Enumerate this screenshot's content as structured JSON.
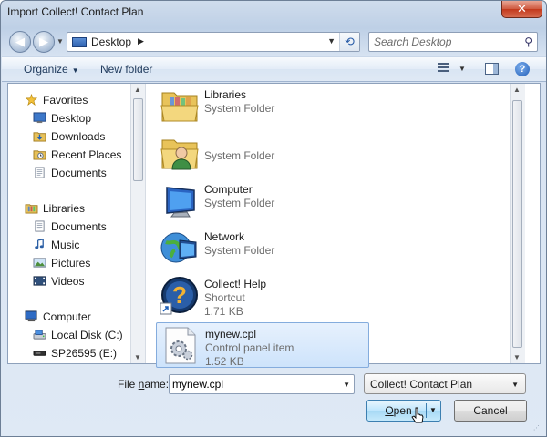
{
  "window": {
    "title": "Import Collect! Contact Plan",
    "close_label": "✕"
  },
  "address_bar": {
    "location": "Desktop",
    "search_placeholder": "Search Desktop"
  },
  "toolbar": {
    "organize_label": "Organize",
    "new_folder_label": "New folder"
  },
  "nav_pane": {
    "groups": [
      {
        "label": "Favorites",
        "icon": "star-icon",
        "children": [
          {
            "label": "Desktop",
            "icon": "desktop-icon"
          },
          {
            "label": "Downloads",
            "icon": "downloads-icon"
          },
          {
            "label": "Recent Places",
            "icon": "recent-places-icon"
          },
          {
            "label": "Documents",
            "icon": "documents-icon"
          }
        ]
      },
      {
        "label": "Libraries",
        "icon": "libraries-icon",
        "children": [
          {
            "label": "Documents",
            "icon": "documents-icon"
          },
          {
            "label": "Music",
            "icon": "music-icon"
          },
          {
            "label": "Pictures",
            "icon": "pictures-icon"
          },
          {
            "label": "Videos",
            "icon": "videos-icon"
          }
        ]
      },
      {
        "label": "Computer",
        "icon": "computer-icon",
        "children": [
          {
            "label": "Local Disk (C:)",
            "icon": "local-disk-icon"
          },
          {
            "label": "SP26595 (E:)",
            "icon": "drive-icon"
          }
        ]
      }
    ]
  },
  "files": [
    {
      "name": "Libraries",
      "type": "System Folder",
      "size": "",
      "icon": "libraries-folder-icon",
      "selected": false
    },
    {
      "name": "",
      "type": "System Folder",
      "size": "",
      "icon": "user-folder-icon",
      "selected": false
    },
    {
      "name": "Computer",
      "type": "System Folder",
      "size": "",
      "icon": "computer-icon",
      "selected": false
    },
    {
      "name": "Network",
      "type": "System Folder",
      "size": "",
      "icon": "network-icon",
      "selected": false
    },
    {
      "name": "Collect! Help",
      "type": "Shortcut",
      "size": "1.71 KB",
      "icon": "help-shortcut-icon",
      "selected": false
    },
    {
      "name": "mynew.cpl",
      "type": "Control panel item",
      "size": "1.52 KB",
      "icon": "control-panel-item-icon",
      "selected": true
    }
  ],
  "footer": {
    "file_name_label_prefix": "File ",
    "file_name_label_underlined": "n",
    "file_name_label_suffix": "ame:",
    "file_name_value": "mynew.cpl",
    "filter_value": "Collect! Contact Plan",
    "open_label_underlined": "O",
    "open_label_rest": "pen",
    "cancel_label": "Cancel"
  }
}
